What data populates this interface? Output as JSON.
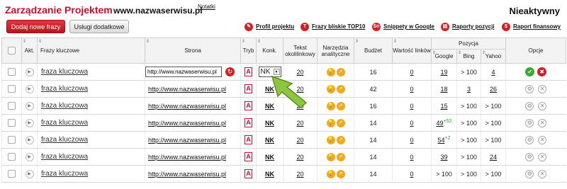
{
  "header": {
    "title": "Zarządzanie Projektem",
    "domain": "www.nazwaserwisu.pl",
    "notes_link": "Notatki",
    "status": "Nieaktywny"
  },
  "toolbar": {
    "add_phrases": "Dodaj nowe frazy",
    "extra_services": "Usługi dodatkowe"
  },
  "quick_links": [
    {
      "label": "Profil projektu",
      "icon": "pencil-icon",
      "glyph": "✎"
    },
    {
      "label": "Frazy bliskie TOP10",
      "icon": "top10-icon",
      "glyph": "T"
    },
    {
      "label": "Snippety w Google",
      "icon": "snippet-icon",
      "glyph": "Sn"
    },
    {
      "label": "Raporty pozycji",
      "icon": "report-icon",
      "glyph": "▤"
    },
    {
      "label": "Raport finansowy",
      "icon": "dollar-icon",
      "glyph": "$"
    }
  ],
  "table": {
    "headers": {
      "akt": "Akt.",
      "keywords": "Frazy kluczowe",
      "page": "Strona",
      "mode": "Tryb",
      "competition": "Konk.",
      "link_text": "Tekst okolilinkowy",
      "analytics": "Narzędzia analityczne",
      "budget": "Budżet",
      "link_value": "Wartość linków",
      "position": "Pozycja",
      "google": "Google",
      "bing": "Bing",
      "yahoo": "Yahoo",
      "options": "Opcje"
    },
    "rows": [
      {
        "keyword": "fraza kluczowa",
        "url": "http://www.nazwaserwisu.pl",
        "mode": "A",
        "competition": "NK",
        "link_text": "20",
        "budget": "16",
        "link_value": "0",
        "google": "19",
        "google_delta": "",
        "bing": "> 100",
        "yahoo": "4",
        "editing": true
      },
      {
        "keyword": "fraza kluczowa",
        "url": "http://www.nazwaserwisu.pl",
        "mode": "A",
        "competition": "NK",
        "link_text": "20",
        "budget": "42",
        "link_value": "0",
        "google": "18",
        "google_delta": "",
        "bing": "3",
        "yahoo": "26",
        "editing": false
      },
      {
        "keyword": "fraza kluczowa",
        "url": "http://www.nazwaserwisu.pl",
        "mode": "A",
        "competition": "NK",
        "link_text": "20",
        "budget": "16",
        "link_value": "0",
        "google": "15",
        "google_delta": "",
        "bing": "> 100",
        "yahoo": "> 100",
        "editing": false
      },
      {
        "keyword": "fraza kluczowa",
        "url": "http://www.nazwaserwisu.pl",
        "mode": "A",
        "competition": "NK",
        "link_text": "20",
        "budget": "14",
        "link_value": "0",
        "google": "49",
        "google_delta": "+52",
        "bing": "> 100",
        "yahoo": "> 100",
        "editing": false
      },
      {
        "keyword": "fraza kluczowa",
        "url": "http://www.nazwaserwisu.pl",
        "mode": "A",
        "competition": "NK",
        "link_text": "20",
        "budget": "14",
        "link_value": "0",
        "google": "54",
        "google_delta": "+2",
        "bing": "> 100",
        "yahoo": "> 100",
        "editing": false
      },
      {
        "keyword": "fraza kluczowa",
        "url": "http://www.nazwaserwisu.pl",
        "mode": "A",
        "competition": "NK",
        "link_text": "20",
        "budget": "14",
        "link_value": "0",
        "google": "39",
        "google_delta": "",
        "bing": "> 100",
        "yahoo": "24",
        "editing": false
      },
      {
        "keyword": "fraza kluczowa",
        "url": "http://www.nazwaserwisu.pl",
        "mode": "A",
        "competition": "NK",
        "link_text": "20",
        "budget": "14",
        "link_value": "0",
        "google": "> 100",
        "google_delta": "",
        "bing": "> 100",
        "yahoo": "> 100",
        "editing": false
      }
    ]
  },
  "colors": {
    "brand_red": "#c8102e",
    "tool_orange": "#f3a91d",
    "ok_green": "#3aa935",
    "pointer_green": "#8cc63f"
  }
}
